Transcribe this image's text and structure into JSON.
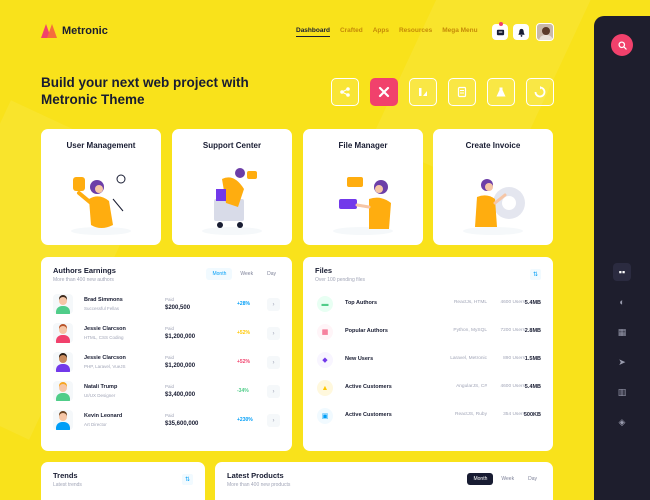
{
  "brand": {
    "name": "Metronic"
  },
  "nav": {
    "items": [
      {
        "label": "Dashboard",
        "active": true
      },
      {
        "label": "Crafted",
        "active": false
      },
      {
        "label": "Apps",
        "active": false
      },
      {
        "label": "Resources",
        "active": false
      },
      {
        "label": "Mega Menu",
        "active": false
      }
    ]
  },
  "hero": {
    "title_line1": "Build your next web project with",
    "title_line2": "Metronic Theme"
  },
  "features": [
    {
      "title": "User Management"
    },
    {
      "title": "Support Center"
    },
    {
      "title": "File Manager"
    },
    {
      "title": "Create Invoice"
    }
  ],
  "authors": {
    "title": "Authors Earnings",
    "subtitle": "More than 400 new authors",
    "tabs": [
      "Month",
      "Week",
      "Day"
    ],
    "active_tab": "Month",
    "rows": [
      {
        "name": "Brad Simmons",
        "role": "Successful Fellas",
        "paid_label": "Paid",
        "amount": "$200,500",
        "change": "+28%",
        "change_color": "#009ef7",
        "hair": "#3f2a1d",
        "shirt": "#50cd89"
      },
      {
        "name": "Jessie Clarcson",
        "role": "HTML, CSS Coding",
        "paid_label": "Paid",
        "amount": "$1,200,000",
        "change": "+52%",
        "change_color": "#ffc700",
        "hair": "#b8542a",
        "shirt": "#f1416c"
      },
      {
        "name": "Jessie Clarcson",
        "role": "PHP, Laravel, VueJS",
        "paid_label": "Paid",
        "amount": "$1,200,000",
        "change": "+52%",
        "change_color": "#f1416c",
        "hair": "#2b1d14",
        "shirt": "#7239ea"
      },
      {
        "name": "Natali Trump",
        "role": "UI/UX Designer",
        "paid_label": "Paid",
        "amount": "$3,400,000",
        "change": "-34%",
        "change_color": "#50cd89",
        "hair": "#f6a623",
        "shirt": "#50cd89"
      },
      {
        "name": "Kevin Leonard",
        "role": "Art Director",
        "paid_label": "Paid",
        "amount": "$35,600,000",
        "change": "+230%",
        "change_color": "#009ef7",
        "hair": "#6b4423",
        "shirt": "#009ef7"
      }
    ]
  },
  "files": {
    "title": "Files",
    "subtitle": "Over 100 pending files",
    "rows": [
      {
        "name": "Top Authors",
        "tech": "ReactJs, HTML",
        "users": "4600 Users",
        "size": "5.4MB",
        "icon_bg": "#e8fff3",
        "icon_color": "#50cd89",
        "icon": "▬"
      },
      {
        "name": "Popular Authors",
        "tech": "Python, MySQL",
        "users": "7200 Users",
        "size": "2.8MB",
        "icon_bg": "#fff5f8",
        "icon_color": "#f1416c",
        "icon": "▦"
      },
      {
        "name": "New Users",
        "tech": "Laravel, Metronic",
        "users": "890 Users",
        "size": "1.5MB",
        "icon_bg": "#f8f5ff",
        "icon_color": "#7239ea",
        "icon": "◆"
      },
      {
        "name": "Active Customers",
        "tech": "AngularJS, C#",
        "users": "4600 Users",
        "size": "5.4MB",
        "icon_bg": "#fff8dd",
        "icon_color": "#ffc700",
        "icon": "▲"
      },
      {
        "name": "Active Customers",
        "tech": "ReactJS, Ruby",
        "users": "354 Users",
        "size": "500KB",
        "icon_bg": "#f1faff",
        "icon_color": "#009ef7",
        "icon": "▣"
      }
    ]
  },
  "trends": {
    "title": "Trends",
    "subtitle": "Latest trends"
  },
  "latest_products": {
    "title": "Latest Products",
    "subtitle": "More than 400 new products",
    "tabs": [
      "Month",
      "Week",
      "Day"
    ],
    "active_tab": "Month"
  },
  "colors": {
    "background": "#f9e21b",
    "accent": "#f1416c",
    "sidebar": "#1e1e2d",
    "primary": "#009ef7"
  }
}
